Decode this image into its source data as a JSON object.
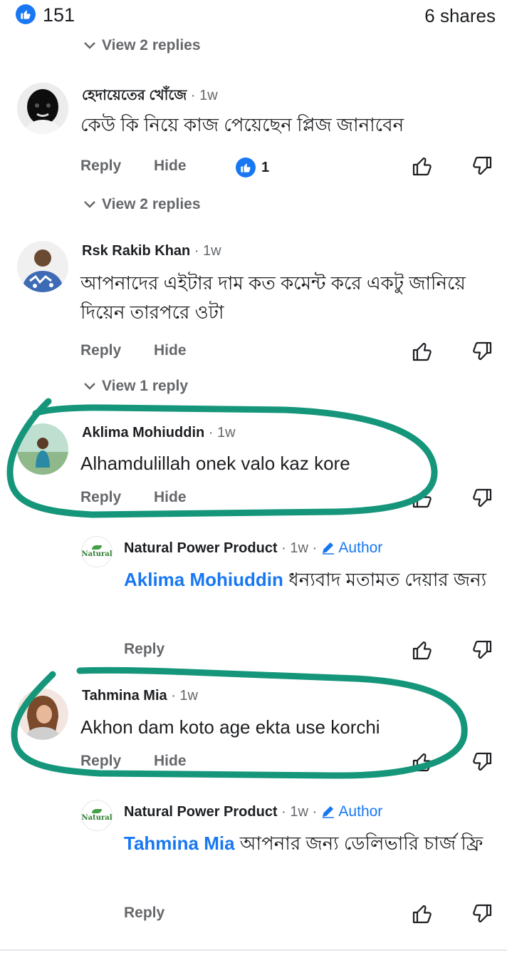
{
  "header": {
    "like_count": "151",
    "shares": "6 shares"
  },
  "view_replies": [
    "View 2 replies",
    "View 2 replies",
    "View 1 reply"
  ],
  "actions": {
    "reply": "Reply",
    "hide": "Hide"
  },
  "comments": [
    {
      "name": "হেদায়েতের খোঁজে",
      "time": "· 1w",
      "text": "কেউ কি নিয়ে কাজ পেয়েছেন প্লিজ জানাবেন",
      "reaction_count": "1"
    },
    {
      "name": "Rsk Rakib Khan",
      "time": "· 1w",
      "text": "আপনাদের এইটার দাম কত কমেন্ট করে একটু জানিয়ে দিয়েন তারপরে ওটা"
    },
    {
      "name": "Aklima Mohiuddin",
      "time": "· 1w",
      "text": "Alhamdulillah onek valo kaz kore"
    },
    {
      "name": "Natural Power Product",
      "time": "· 1w ·",
      "author": "Author",
      "mention": "Aklima Mohiuddin",
      "text": "ধন্যবাদ মতামত দেয়ার জন্য"
    },
    {
      "name": "Tahmina Mia",
      "time": "· 1w",
      "text": "Akhon dam koto age ekta use korchi"
    },
    {
      "name": "Natural Power Product",
      "time": "· 1w ·",
      "author": "Author",
      "mention": "Tahmina Mia",
      "text": "আপনার জন্য ডেলিভারি চার্জ ফ্রি"
    }
  ],
  "logo_text": "Natural",
  "colors": {
    "accent": "#1877f2",
    "annotation": "#15967a",
    "secondary_text": "#65676b"
  }
}
